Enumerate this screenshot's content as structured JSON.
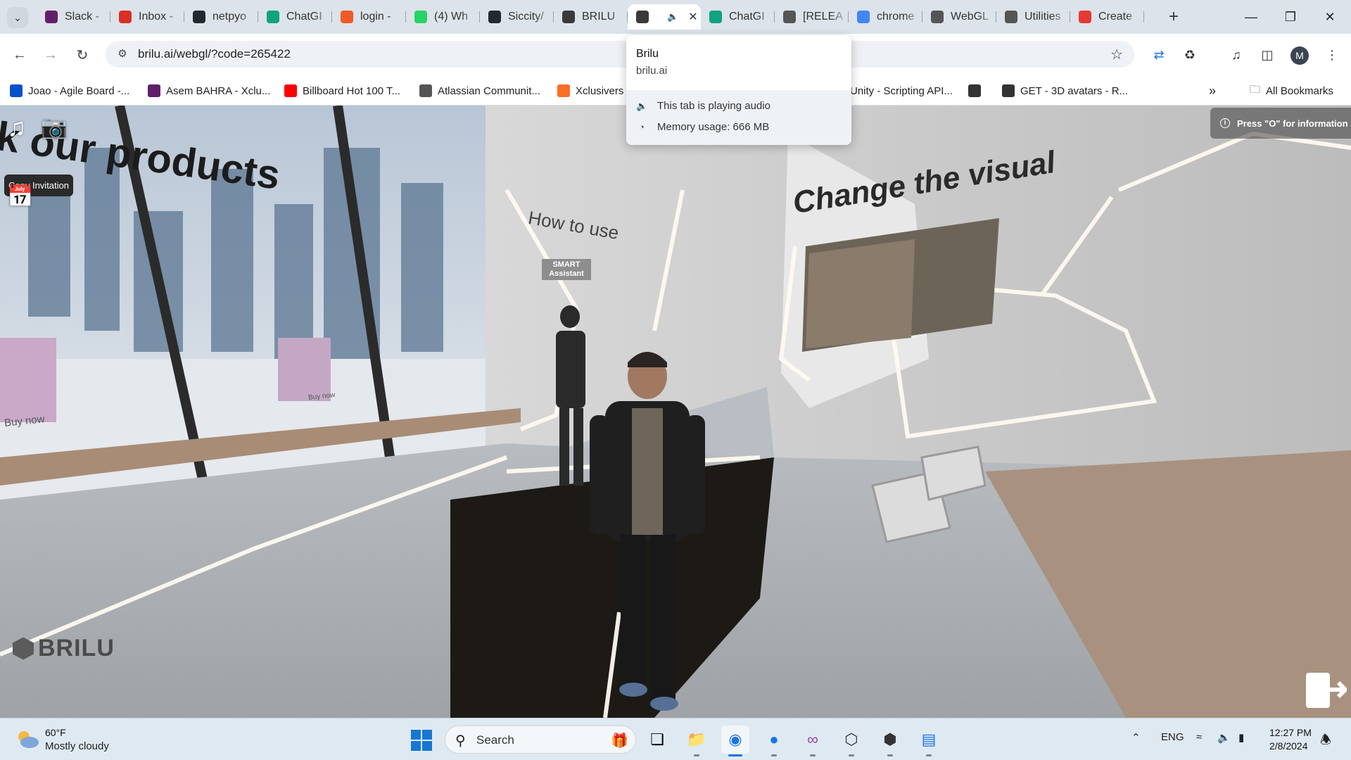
{
  "browser": {
    "tabs": [
      {
        "label": "Slack -",
        "icon": "slack-icon",
        "color": "#611f69"
      },
      {
        "label": "Inbox -",
        "icon": "gmail-icon",
        "color": "#d93025"
      },
      {
        "label": "netpyo",
        "icon": "github-icon",
        "color": "#24292f"
      },
      {
        "label": "ChatGI",
        "icon": "chatgpt-icon",
        "color": "#10a37f"
      },
      {
        "label": "login -",
        "icon": "login-icon",
        "color": "#f05a28"
      },
      {
        "label": "(4) Wh",
        "icon": "whatsapp-icon",
        "color": "#25d366"
      },
      {
        "label": "Siccity/",
        "icon": "github-icon",
        "color": "#24292f"
      },
      {
        "label": "BRILU",
        "icon": "brilu-icon",
        "color": "#3a3a3a"
      },
      {
        "label": "",
        "icon": "brilu-icon",
        "color": "#3a3a3a",
        "active": true
      },
      {
        "label": "ChatGI",
        "icon": "chatgpt-icon",
        "color": "#10a37f"
      },
      {
        "label": "[RELEA",
        "icon": "unity-icon",
        "color": "#555555"
      },
      {
        "label": "chrome",
        "icon": "google-icon",
        "color": "#4285f4"
      },
      {
        "label": "WebGL",
        "icon": "unity-icon",
        "color": "#555555"
      },
      {
        "label": "Utilities",
        "icon": "unity-icon",
        "color": "#555555"
      },
      {
        "label": "Create",
        "icon": "create-icon",
        "color": "#e53935"
      }
    ],
    "url": "brilu.ai/webgl/?code=265422",
    "bookmarks": [
      {
        "label": "Joao - Agile Board -...",
        "icon": "jira-icon",
        "color": "#0052cc"
      },
      {
        "label": "Asem BAHRA - Xclu...",
        "icon": "slack-icon",
        "color": "#611f69"
      },
      {
        "label": "Billboard Hot 100 T...",
        "icon": "youtube-icon",
        "color": "#ff0000"
      },
      {
        "label": "Atlassian Communit...",
        "icon": "atlassian-icon",
        "color": "#555555"
      },
      {
        "label": "Xclusivers",
        "icon": "gitlab-icon",
        "color": "#fc6d26"
      },
      {
        "label": "Unity - Scripting API...",
        "icon": "",
        "color": ""
      },
      {
        "label": "",
        "icon": "unity-icon",
        "color": "#333333"
      },
      {
        "label": "GET - 3D avatars - R...",
        "icon": "api-icon",
        "color": "#333333"
      }
    ],
    "all_bookmarks": "All Bookmarks",
    "profile_initial": "M"
  },
  "hovercard": {
    "title": "Brilu",
    "domain": "brilu.ai",
    "audio": "This tab is playing audio",
    "memory": "Memory usage: 666 MB"
  },
  "scene": {
    "wall_text_products": "k our products",
    "wall_text_how": "How to use",
    "wall_text_visual": "Change the visual",
    "smart_assistant": [
      "SMART",
      "Assistant"
    ],
    "buy_now": "Buy now",
    "buy_now_small": "Buy now",
    "copy_invitation": "Copy Invitation",
    "info_hint": "Press \"O\" for information",
    "logo": "BRILU"
  },
  "taskbar": {
    "weather_temp": "60°F",
    "weather_desc": "Mostly cloudy",
    "search_label": "Search",
    "lang": "ENG",
    "time": "12:27 PM",
    "date": "2/8/2024"
  }
}
